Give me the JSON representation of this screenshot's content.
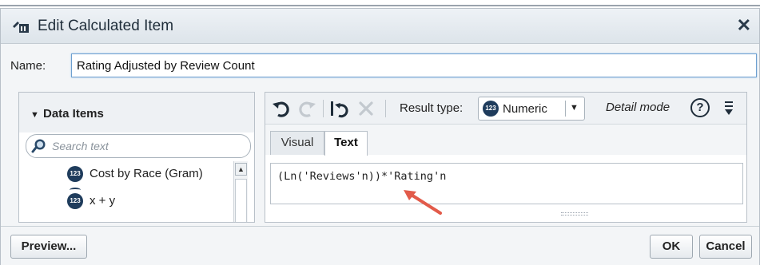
{
  "dialog": {
    "title": "Edit Calculated Item",
    "close_glyph": "✕",
    "title_icon": "calculated-item-icon"
  },
  "name": {
    "label": "Name:",
    "value": "Rating Adjusted by Review Count"
  },
  "data_items": {
    "header": "Data Items",
    "search_placeholder": "Search text",
    "items": [
      {
        "badge": "123",
        "label": "Cost by Race (Gram)"
      },
      {
        "badge": "123",
        "label": "x + y"
      }
    ]
  },
  "toolbar": {
    "result_type_label": "Result type:",
    "result_type_value": "Numeric",
    "result_type_badge": "123",
    "detail_mode_label": "Detail mode",
    "help_glyph": "?"
  },
  "tabs": [
    {
      "label": "Visual",
      "active": false
    },
    {
      "label": "Text",
      "active": true
    }
  ],
  "expression": "(Ln('Reviews'n))*'Rating'n",
  "footer": {
    "preview_label": "Preview...",
    "ok_label": "OK",
    "cancel_label": "Cancel"
  },
  "colors": {
    "accent_arrow": "#e25b4a",
    "badge": "#1f3c5c"
  }
}
